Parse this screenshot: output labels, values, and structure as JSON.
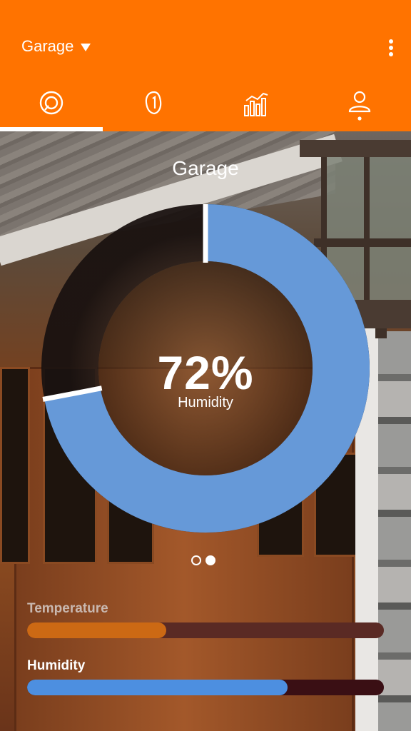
{
  "header": {
    "location": "Garage",
    "tabs": [
      {
        "name": "dashboard",
        "icon": "gauge-icon",
        "active": true
      },
      {
        "name": "sensor",
        "icon": "sensor-icon",
        "active": false
      },
      {
        "name": "statistics",
        "icon": "bar-chart-icon",
        "active": false
      },
      {
        "name": "profile",
        "icon": "user-icon",
        "active": false
      }
    ],
    "colors": {
      "accent": "#ff7300"
    }
  },
  "main": {
    "title": "Garage",
    "gauge": {
      "value": 72,
      "value_text": "72%",
      "label": "Humidity",
      "color": "#6699d8"
    },
    "pager": {
      "pages": 2,
      "active_index": 1
    }
  },
  "metrics": [
    {
      "label": "Temperature",
      "level": 0.39,
      "color": "#e07412",
      "track_color": "#5a2a24"
    },
    {
      "label": "Humidity",
      "level": 0.73,
      "color": "#4d8fe0",
      "track_color": "#3a0f14"
    }
  ]
}
